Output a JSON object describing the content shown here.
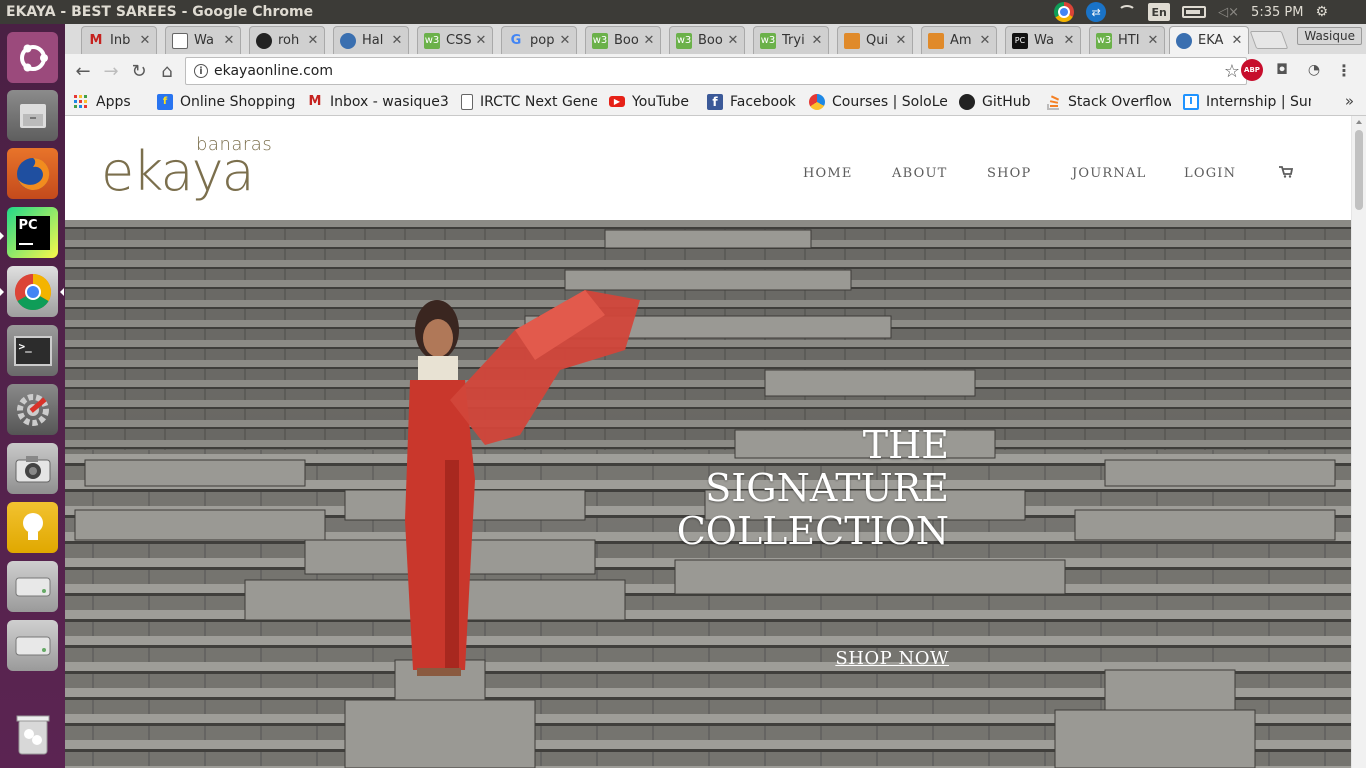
{
  "window": {
    "title": "EKAYA - BEST SAREES - Google Chrome"
  },
  "tray": {
    "language": "En",
    "clock": "5:35 PM"
  },
  "launcher": [
    {
      "name": "ubuntu-dash-icon"
    },
    {
      "name": "files-icon"
    },
    {
      "name": "firefox-icon"
    },
    {
      "name": "pycharm-icon"
    },
    {
      "name": "chrome-icon"
    },
    {
      "name": "terminal-icon"
    },
    {
      "name": "system-settings-icon"
    },
    {
      "name": "camera-icon"
    },
    {
      "name": "idea-bulb-icon"
    },
    {
      "name": "drive-icon"
    },
    {
      "name": "drive-icon"
    },
    {
      "name": "trash-icon"
    }
  ],
  "tabs": [
    {
      "title": "Inb",
      "icon": "gmail-icon"
    },
    {
      "title": "Wa",
      "icon": "page-icon"
    },
    {
      "title": "roh",
      "icon": "github-icon"
    },
    {
      "title": "Hal",
      "icon": "blue-drop-icon"
    },
    {
      "title": "CSS",
      "icon": "w3schools-icon"
    },
    {
      "title": "pop",
      "icon": "google-icon"
    },
    {
      "title": "Boo",
      "icon": "w3schools-icon"
    },
    {
      "title": "Boo",
      "icon": "w3schools-icon"
    },
    {
      "title": "Tryi",
      "icon": "w3schools-icon"
    },
    {
      "title": "Qui",
      "icon": "box-icon"
    },
    {
      "title": "Am",
      "icon": "box-icon"
    },
    {
      "title": "Wa",
      "icon": "pycharm-icon"
    },
    {
      "title": "HTI",
      "icon": "w3schools-icon"
    },
    {
      "title": "EKA",
      "icon": "blue-drop-icon",
      "active": true
    }
  ],
  "profile": "Wasique",
  "url": "ekayaonline.com",
  "bookmarks": [
    {
      "label": "Apps",
      "icon": "apps-grid-icon"
    },
    {
      "label": "Online Shopping",
      "icon": "flipkart-icon"
    },
    {
      "label": "Inbox - wasique3",
      "icon": "gmail-icon"
    },
    {
      "label": "IRCTC Next Gene",
      "icon": "page-icon"
    },
    {
      "label": "YouTube",
      "icon": "youtube-icon"
    },
    {
      "label": "Facebook",
      "icon": "facebook-icon"
    },
    {
      "label": "Courses | SoloLe",
      "icon": "sololearn-icon"
    },
    {
      "label": "GitHub",
      "icon": "github-icon"
    },
    {
      "label": "Stack Overflow",
      "icon": "stackoverflow-icon"
    },
    {
      "label": "Internship | Sum",
      "icon": "internshala-icon"
    }
  ],
  "site": {
    "logo_sub": "banaras",
    "logo_main": "ekaya",
    "menu": [
      "HOME",
      "ABOUT",
      "SHOP",
      "JOURNAL",
      "LOGIN"
    ],
    "hero_title": [
      "THE",
      "SIGNATURE",
      "COLLECTION"
    ],
    "cta": "SHOP NOW"
  },
  "colors": {
    "brand": "#7b6f4d",
    "launcher": "#5b2452",
    "saree": "#c9372c"
  }
}
